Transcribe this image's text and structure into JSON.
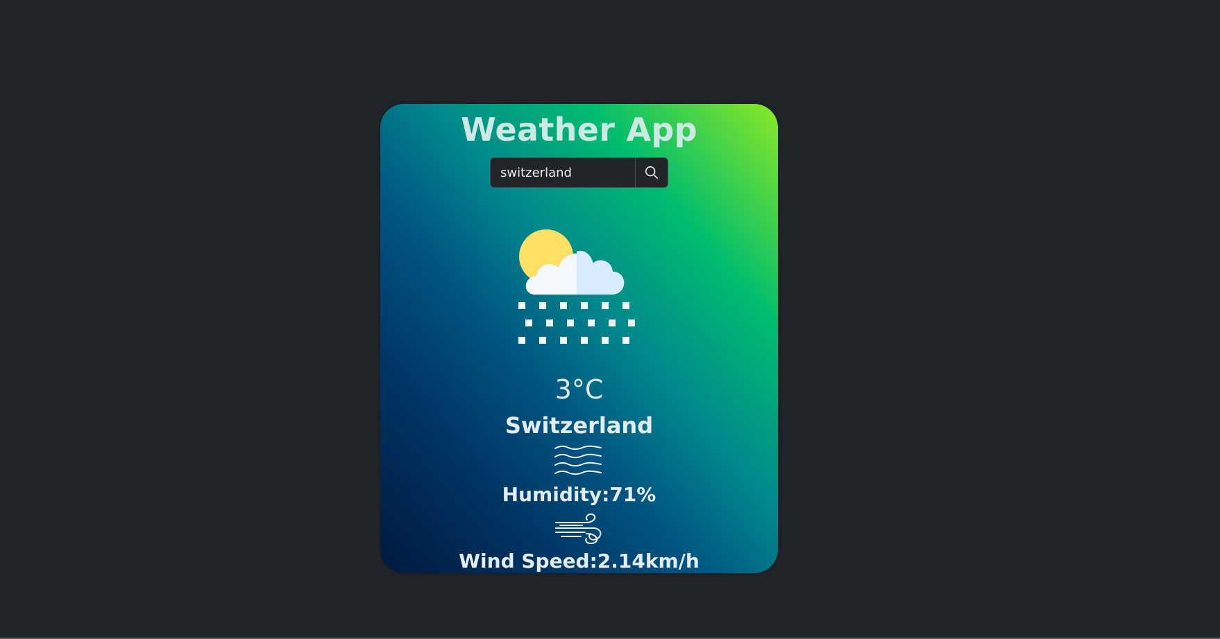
{
  "app": {
    "title": "Weather App"
  },
  "search": {
    "value": "switzerland",
    "button_icon": "search-icon"
  },
  "weather": {
    "icon": "snow-cloud-sun-icon",
    "temperature": "3°C",
    "city": "Switzerland",
    "humidity_icon": "humidity-waves-icon",
    "humidity": "Humidity:71%",
    "wind_icon": "wind-icon",
    "wind_speed": "Wind Speed:2.14km/h"
  },
  "colors": {
    "page_background": "#212429",
    "card_gradient": [
      "#001a3d",
      "#003463",
      "#005582",
      "#008a8c",
      "#00bd6e",
      "#8ce825"
    ],
    "text": "#e3ecf0",
    "sun": "#ffe064",
    "cloud_left": "#f2f8fb",
    "cloud_right": "#d9ecff"
  }
}
